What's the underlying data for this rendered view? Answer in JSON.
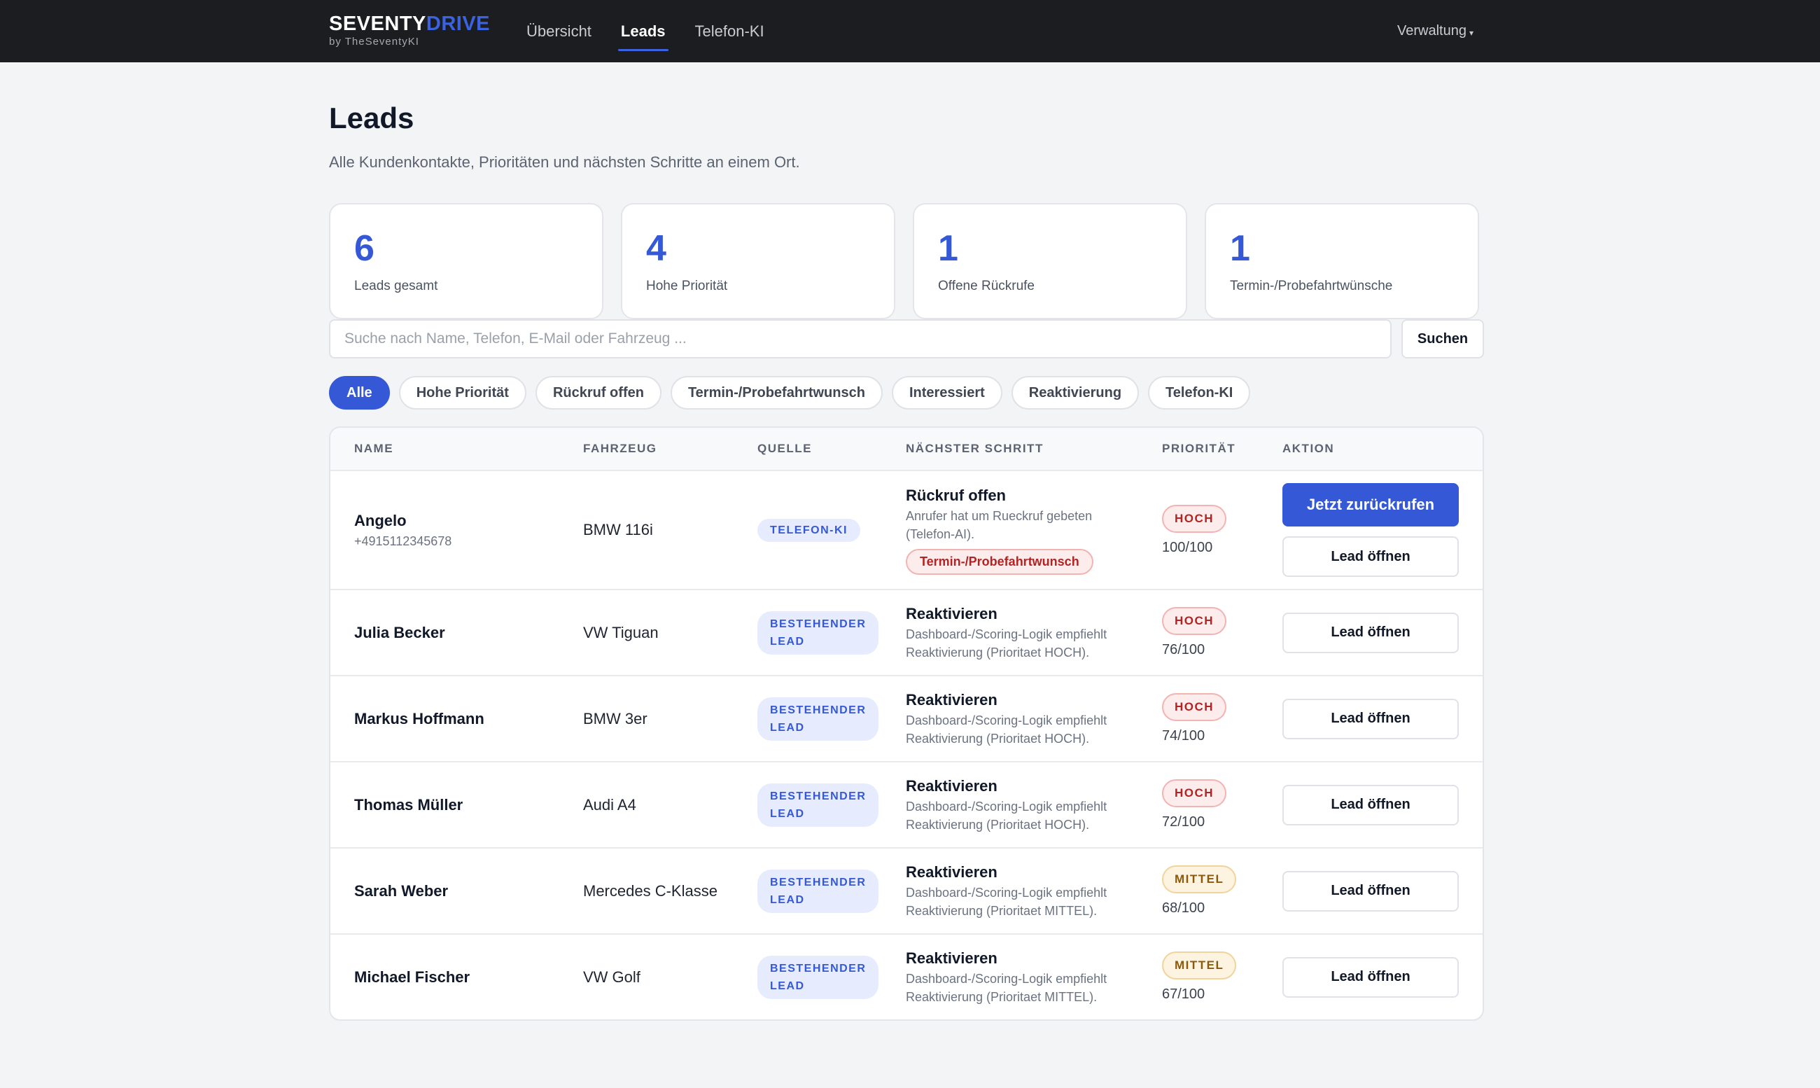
{
  "header": {
    "brand_primary": "SEVENTY",
    "brand_accent": "DRIVE",
    "brand_sub": "by TheSeventyKI",
    "nav": [
      {
        "label": "Übersicht",
        "active": false
      },
      {
        "label": "Leads",
        "active": true
      },
      {
        "label": "Telefon-KI",
        "active": false
      }
    ],
    "admin_label": "Verwaltung",
    "admin_icon": "caret-down-icon"
  },
  "page": {
    "title": "Leads",
    "subtitle": "Alle Kundenkontakte, Prioritäten und nächsten Schritte an einem Ort."
  },
  "stats": [
    {
      "value": "6",
      "label": "Leads gesamt"
    },
    {
      "value": "4",
      "label": "Hohe Priorität"
    },
    {
      "value": "1",
      "label": "Offene Rückrufe"
    },
    {
      "value": "1",
      "label": "Termin-/Probefahrtwünsche"
    }
  ],
  "search": {
    "placeholder": "Suche nach Name, Telefon, E-Mail oder Fahrzeug ...",
    "value": "",
    "button_label": "Suchen"
  },
  "filters": [
    {
      "label": "Alle",
      "active": true
    },
    {
      "label": "Hohe Priorität",
      "active": false
    },
    {
      "label": "Rückruf offen",
      "active": false
    },
    {
      "label": "Termin-/Probefahrtwunsch",
      "active": false
    },
    {
      "label": "Interessiert",
      "active": false
    },
    {
      "label": "Reaktivierung",
      "active": false
    },
    {
      "label": "Telefon-KI",
      "active": false
    }
  ],
  "table": {
    "columns": [
      "NAME",
      "FAHRZEUG",
      "QUELLE",
      "NÄCHSTER SCHRITT",
      "PRIORITÄT",
      "AKTION"
    ],
    "rows": [
      {
        "name": "Angelo",
        "phone": "+4915112345678",
        "vehicle": "BMW 116i",
        "source": "TELEFON-KI",
        "next_title": "Rückruf offen",
        "next_desc_1": "Anrufer hat um Rueckruf gebeten",
        "next_desc_2": "(Telefon-AI).",
        "next_tag": "Termin-/Probefahrtwunsch",
        "priority": "HOCH",
        "priority_level": "hoch",
        "score": "100/100",
        "primary_action": "Jetzt zurückrufen",
        "secondary_action": "Lead öffnen"
      },
      {
        "name": "Julia Becker",
        "vehicle": "VW Tiguan",
        "source_1": "BESTEHENDER",
        "source_2": "LEAD",
        "next_title": "Reaktivieren",
        "next_desc_1": "Dashboard-/Scoring-Logik empfiehlt",
        "next_desc_2": "Reaktivierung (Prioritaet HOCH).",
        "priority": "HOCH",
        "priority_level": "hoch",
        "score": "76/100",
        "secondary_action": "Lead öffnen"
      },
      {
        "name": "Markus Hoffmann",
        "vehicle": "BMW 3er",
        "source_1": "BESTEHENDER",
        "source_2": "LEAD",
        "next_title": "Reaktivieren",
        "next_desc_1": "Dashboard-/Scoring-Logik empfiehlt",
        "next_desc_2": "Reaktivierung (Prioritaet HOCH).",
        "priority": "HOCH",
        "priority_level": "hoch",
        "score": "74/100",
        "secondary_action": "Lead öffnen"
      },
      {
        "name": "Thomas Müller",
        "vehicle": "Audi A4",
        "source_1": "BESTEHENDER",
        "source_2": "LEAD",
        "next_title": "Reaktivieren",
        "next_desc_1": "Dashboard-/Scoring-Logik empfiehlt",
        "next_desc_2": "Reaktivierung (Prioritaet HOCH).",
        "priority": "HOCH",
        "priority_level": "hoch",
        "score": "72/100",
        "secondary_action": "Lead öffnen"
      },
      {
        "name": "Sarah Weber",
        "vehicle": "Mercedes C-Klasse",
        "source_1": "BESTEHENDER",
        "source_2": "LEAD",
        "next_title": "Reaktivieren",
        "next_desc_1": "Dashboard-/Scoring-Logik empfiehlt",
        "next_desc_2": "Reaktivierung (Prioritaet MITTEL).",
        "priority": "MITTEL",
        "priority_level": "mittel",
        "score": "68/100",
        "secondary_action": "Lead öffnen"
      },
      {
        "name": "Michael Fischer",
        "vehicle": "VW Golf",
        "source_1": "BESTEHENDER",
        "source_2": "LEAD",
        "next_title": "Reaktivieren",
        "next_desc_1": "Dashboard-/Scoring-Logik empfiehlt",
        "next_desc_2": "Reaktivierung (Prioritaet MITTEL).",
        "priority": "MITTEL",
        "priority_level": "mittel",
        "score": "67/100",
        "secondary_action": "Lead öffnen"
      }
    ]
  },
  "colors": {
    "accent": "#3559d6",
    "nav_bg": "#1c1d21",
    "priority_high": "#b42323",
    "priority_medium": "#8a5a0c"
  }
}
